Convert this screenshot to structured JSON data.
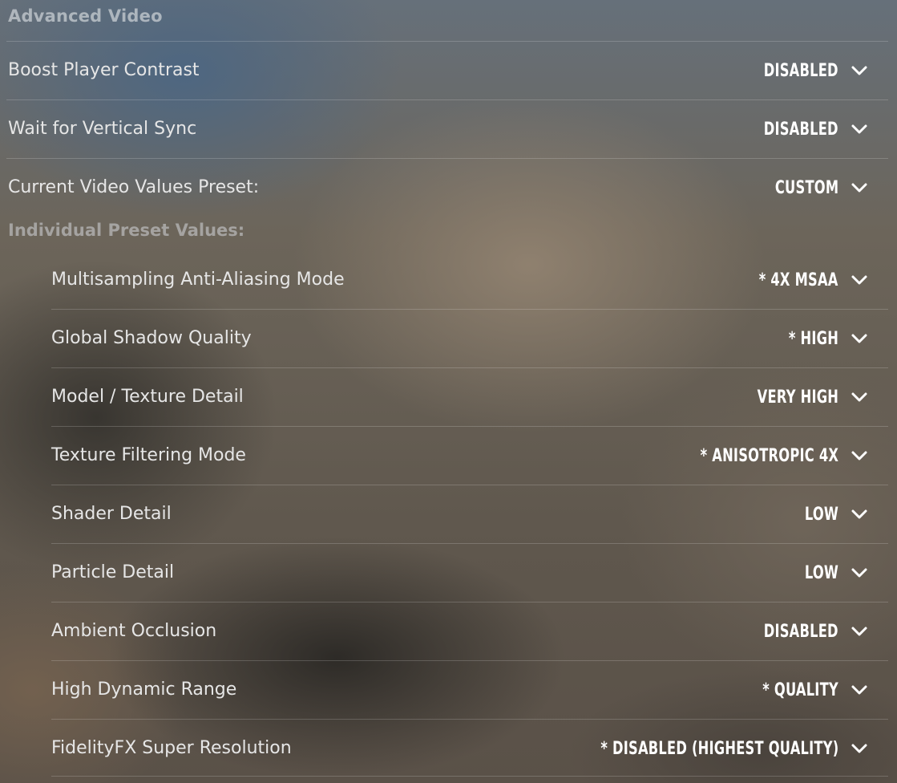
{
  "section_title": "Advanced Video",
  "settings": [
    {
      "label": "Boost Player Contrast",
      "value": "DISABLED"
    },
    {
      "label": "Wait for Vertical Sync",
      "value": "DISABLED"
    },
    {
      "label": "Current Video Values Preset:",
      "value": "CUSTOM"
    }
  ],
  "preset_header": "Individual Preset Values:",
  "preset_settings": [
    {
      "label": "Multisampling Anti-Aliasing Mode",
      "value": "* 4X MSAA"
    },
    {
      "label": "Global Shadow Quality",
      "value": "* HIGH"
    },
    {
      "label": "Model / Texture Detail",
      "value": "VERY HIGH"
    },
    {
      "label": "Texture Filtering Mode",
      "value": "* ANISOTROPIC 4X"
    },
    {
      "label": "Shader Detail",
      "value": "LOW"
    },
    {
      "label": "Particle Detail",
      "value": "LOW"
    },
    {
      "label": "Ambient Occlusion",
      "value": "DISABLED"
    },
    {
      "label": "High Dynamic Range",
      "value": "* QUALITY"
    },
    {
      "label": "FidelityFX Super Resolution",
      "value": "* DISABLED (HIGHEST QUALITY)"
    }
  ],
  "icons": {
    "dropdown": "chevron-down-icon"
  },
  "colors": {
    "label_text": "#e6e6e6",
    "value_text": "#ffffff",
    "header_text": "#c8cacd",
    "divider": "rgba(255,255,255,0.18)"
  }
}
